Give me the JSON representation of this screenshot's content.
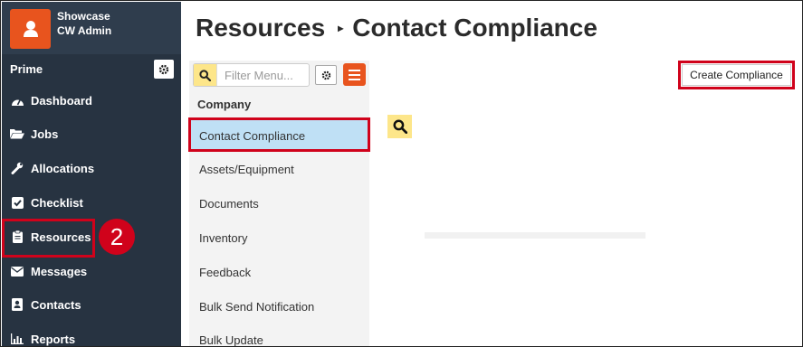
{
  "sidebar": {
    "brand_title": "Showcase",
    "brand_subtitle": "CW Admin",
    "section_title": "Prime",
    "items": [
      {
        "label": "Dashboard",
        "icon": "dashboard-icon"
      },
      {
        "label": "Jobs",
        "icon": "folder-open-icon"
      },
      {
        "label": "Allocations",
        "icon": "wrench-icon"
      },
      {
        "label": "Checklist",
        "icon": "check-square-icon"
      },
      {
        "label": "Resources",
        "icon": "clipboard-icon"
      },
      {
        "label": "Messages",
        "icon": "envelope-icon"
      },
      {
        "label": "Contacts",
        "icon": "address-book-icon"
      },
      {
        "label": "Reports",
        "icon": "bar-chart-icon"
      }
    ]
  },
  "annotation": {
    "step_number": "2",
    "color": "#d0021b"
  },
  "header": {
    "breadcrumb_root": "Resources",
    "breadcrumb_current": "Contact Compliance"
  },
  "submenu": {
    "search_placeholder": "Filter Menu...",
    "group_label": "Company",
    "items": [
      {
        "label": "Contact Compliance",
        "active": true
      },
      {
        "label": "Assets/Equipment"
      },
      {
        "label": "Documents"
      },
      {
        "label": "Inventory"
      },
      {
        "label": "Feedback"
      },
      {
        "label": "Bulk Send Notification"
      },
      {
        "label": "Bulk Update"
      }
    ]
  },
  "content": {
    "create_button_label": "Create Compliance"
  },
  "colors": {
    "sidebar_bg": "#273341",
    "accent": "#e8541e",
    "active_item": "#bfe0f5",
    "highlight": "#d0021b",
    "search_yellow": "#fde68a"
  }
}
